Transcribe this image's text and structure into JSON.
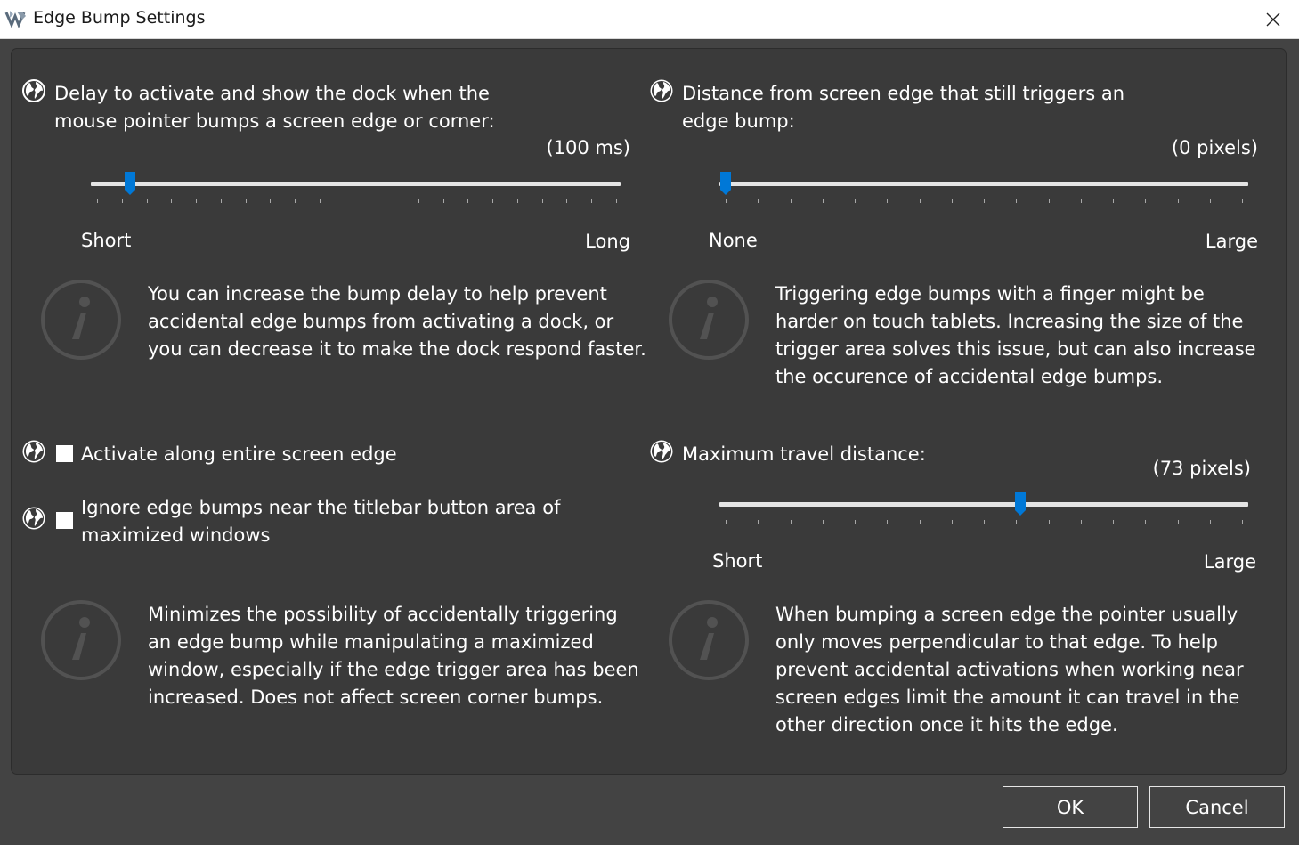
{
  "window": {
    "title": "Edge Bump Settings",
    "icon": "winstep-app-icon",
    "close_icon": "close-icon"
  },
  "delay": {
    "label_line1": "Delay to activate and show the dock when the",
    "label_line2": "mouse pointer bumps a screen edge or corner:",
    "value_text": "(100 ms)",
    "min_label": "Short",
    "max_label": "Long",
    "slider_fraction": 0.064,
    "info_lines": [
      "You can increase the bump delay to help prevent",
      "accidental edge bumps from activating a dock, or",
      "you can decrease it to make the dock respond faster."
    ]
  },
  "distance": {
    "label_line1": "Distance from screen edge that still triggers an",
    "label_line2": "edge bump:",
    "value_text": "(0 pixels)",
    "min_label": "None",
    "max_label": "Large",
    "slider_fraction": 0.0,
    "info_lines": [
      "Triggering edge bumps with a finger might be",
      "harder on touch tablets. Increasing the size of the",
      "trigger area solves this issue, but can also increase",
      "the occurence of accidental edge bumps."
    ]
  },
  "activate_entire_edge": {
    "label": "Activate along entire screen edge",
    "checked": false
  },
  "ignore_titlebar": {
    "label_line1": "Ignore edge bumps near the titlebar button area of",
    "label_line2": "maximized windows",
    "checked": false,
    "info_lines": [
      "Minimizes the possibility of accidentally triggering",
      "an edge bump while manipulating a maximized",
      "window, especially if the edge trigger area has been",
      "increased. Does not affect screen corner bumps."
    ]
  },
  "travel": {
    "label": "Maximum travel distance:",
    "value_text": "(73 pixels)",
    "min_label": "Short",
    "max_label": "Large",
    "slider_fraction": 0.57,
    "info_lines": [
      "When bumping a screen edge the pointer usually",
      "only moves perpendicular to that edge. To help",
      "prevent accidental activations when working near",
      "screen edges limit the amount it can travel in the",
      "other direction once it hits the edge."
    ]
  },
  "buttons": {
    "ok": "OK",
    "cancel": "Cancel"
  },
  "colors": {
    "accent": "#0078d7",
    "background": "#434343",
    "panel": "#3a3a3a"
  }
}
